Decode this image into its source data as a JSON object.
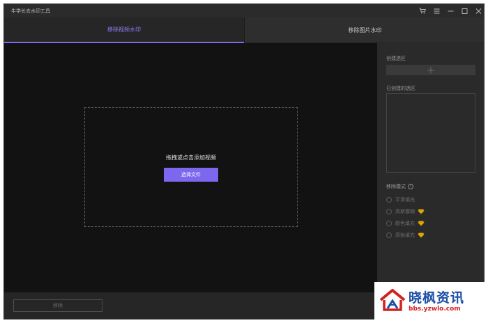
{
  "app": {
    "title": "牛学长去水印工具"
  },
  "window_controls": [
    {
      "name": "cart-icon",
      "glyph": "cart"
    },
    {
      "name": "menu-icon",
      "glyph": "menu"
    },
    {
      "name": "minimize-icon",
      "glyph": "minimize"
    },
    {
      "name": "maximize-icon",
      "glyph": "maximize"
    },
    {
      "name": "close-icon",
      "glyph": "close"
    }
  ],
  "tabs": [
    {
      "label": "移除视频水印",
      "active": true
    },
    {
      "label": "移除图片水印",
      "active": false
    }
  ],
  "main": {
    "drop_text": "拖拽或点击添加视频",
    "select_button": "选择文件"
  },
  "side": {
    "create_area_label": "创建选区",
    "add_icon": "plus-icon",
    "created_areas_label": "已创建的选区",
    "mode_label": "移除模式",
    "mode_help": "?",
    "modes": [
      {
        "label": "平滑填充",
        "vip": false
      },
      {
        "label": "高斯模糊",
        "vip": true
      },
      {
        "label": "颜色填充",
        "vip": true
      },
      {
        "label": "原始填充",
        "vip": true
      }
    ]
  },
  "bottom": {
    "remove_button": "移除"
  },
  "watermark": {
    "title": "晓枫资讯",
    "url": "bbs.yzwlo.com"
  },
  "colors": {
    "accent": "#7b68ee",
    "vip_gold": "#f0b400",
    "watermark_blue": "#1b4fa8",
    "watermark_red": "#d32020"
  }
}
